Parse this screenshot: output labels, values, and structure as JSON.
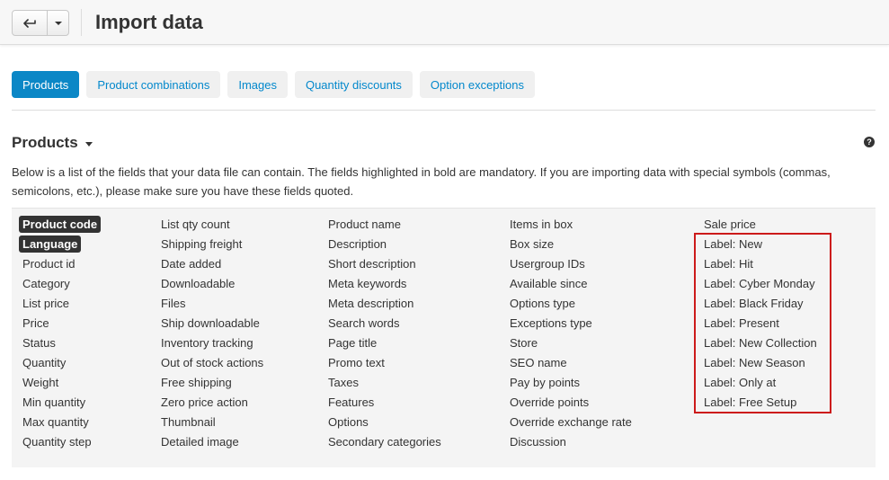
{
  "header": {
    "title": "Import data"
  },
  "tabs": [
    {
      "label": "Products",
      "active": true
    },
    {
      "label": "Product combinations",
      "active": false
    },
    {
      "label": "Images",
      "active": false
    },
    {
      "label": "Quantity discounts",
      "active": false
    },
    {
      "label": "Option exceptions",
      "active": false
    }
  ],
  "section": {
    "title": "Products",
    "help": "?",
    "description": "Below is a list of the fields that your data file can contain. The fields highlighted in bold are mandatory. If you are importing data with special symbols (commas, semicolons, etc.), please make sure you have these fields quoted."
  },
  "columns": [
    [
      "Product code",
      "Language",
      "Product id",
      "Category",
      "List price",
      "Price",
      "Status",
      "Quantity",
      "Weight",
      "Min quantity",
      "Max quantity",
      "Quantity step"
    ],
    [
      "List qty count",
      "Shipping freight",
      "Date added",
      "Downloadable",
      "Files",
      "Ship downloadable",
      "Inventory tracking",
      "Out of stock actions",
      "Free shipping",
      "Zero price action",
      "Thumbnail",
      "Detailed image"
    ],
    [
      "Product name",
      "Description",
      "Short description",
      "Meta keywords",
      "Meta description",
      "Search words",
      "Page title",
      "Promo text",
      "Taxes",
      "Features",
      "Options",
      "Secondary categories"
    ],
    [
      "Items in box",
      "Box size",
      "Usergroup IDs",
      "Available since",
      "Options type",
      "Exceptions type",
      "Store",
      "SEO name",
      "Pay by points",
      "Override points",
      "Override exchange rate",
      "Discussion"
    ],
    [
      "Sale price",
      "Label: New",
      "Label: Hit",
      "Label: Cyber Monday",
      "Label: Black Friday",
      "Label: Present",
      "Label: New Collection",
      "Label: New Season",
      "Label: Only at",
      "Label: Free Setup"
    ]
  ],
  "mandatory_fields": [
    "Product code",
    "Language"
  ],
  "colors": {
    "accent": "#0b87c6",
    "link": "#0388cc",
    "highlight_border": "#cc1a1a"
  }
}
